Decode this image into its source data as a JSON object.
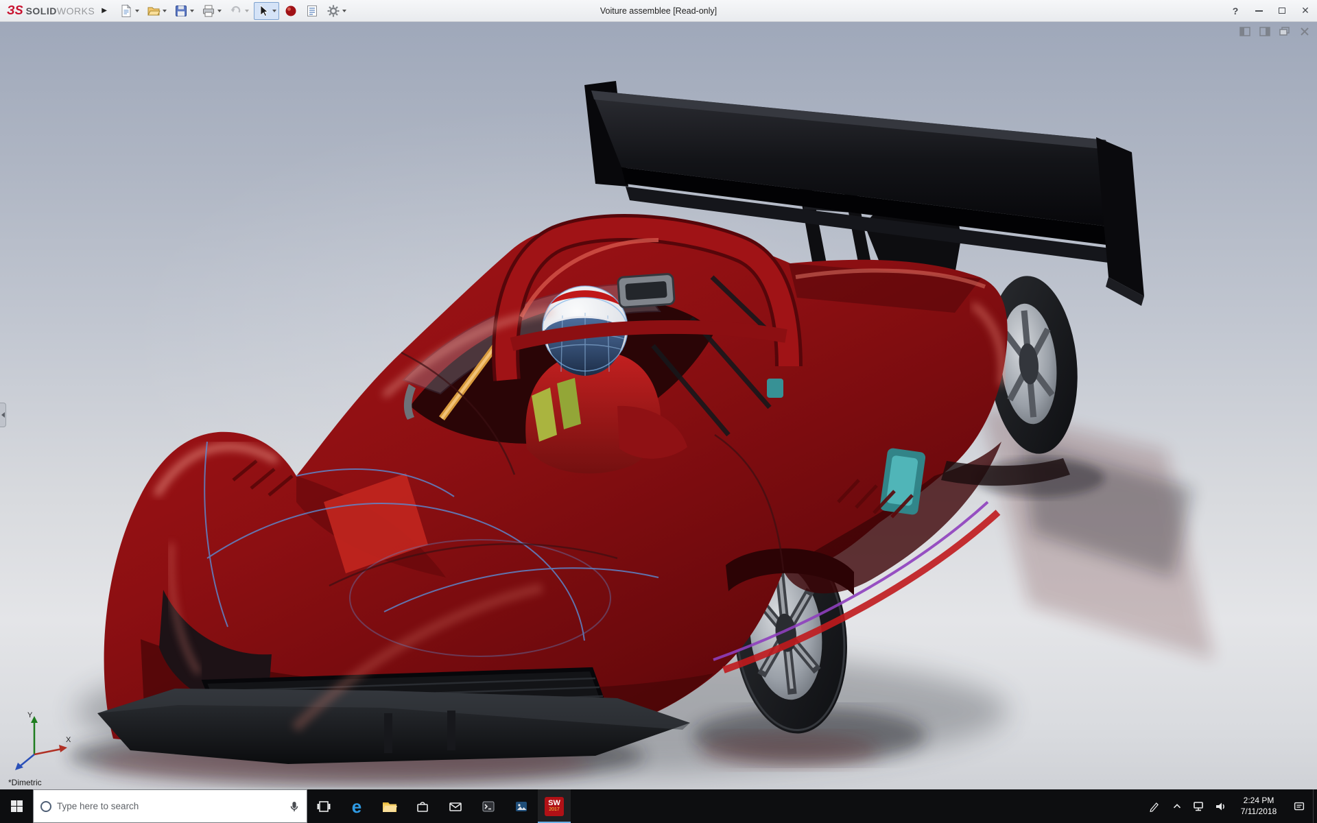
{
  "titlebar": {
    "brand_mark": "ЗS",
    "brand_solid": "SOLID",
    "brand_works": "WORKS",
    "menu_expand_arrow": "▶",
    "title": "Voiture assemblee [Read-only]",
    "controls": {
      "help": "?",
      "close": "✕"
    },
    "toolbar_icons": [
      "new-document",
      "open",
      "save",
      "print",
      "undo",
      "select-tool",
      "appearances-sphere",
      "file-properties",
      "options-gear"
    ]
  },
  "viewport": {
    "view_orientation_label": "*Dimetric",
    "triad": {
      "x_label": "X",
      "y_label": "Y"
    },
    "document_window_controls": [
      "tile-left",
      "tile-right",
      "restore",
      "close"
    ],
    "model": {
      "title": "Voiture assemblee",
      "body_color": "#8c0f12",
      "wing_color": "#0c0c0e",
      "highlight_color": "#d4554a",
      "selected_edge_color": "#d89a3c",
      "sketch_edge_color": "#5b8dd6"
    }
  },
  "taskbar": {
    "search_placeholder": "Type here to search",
    "app_icons": [
      "start",
      "task-view",
      "edge",
      "file-explorer",
      "store",
      "mail",
      "command-prompt",
      "photos",
      "solidworks-2017"
    ],
    "edge_glyph": "e",
    "solidworks_label": "SW",
    "solidworks_year": "2017",
    "tray_icons": [
      "pen",
      "hidden-icons-chevron",
      "network",
      "volume",
      "action-center"
    ],
    "clock_time": "2:24 PM",
    "clock_date": "7/11/2018"
  }
}
